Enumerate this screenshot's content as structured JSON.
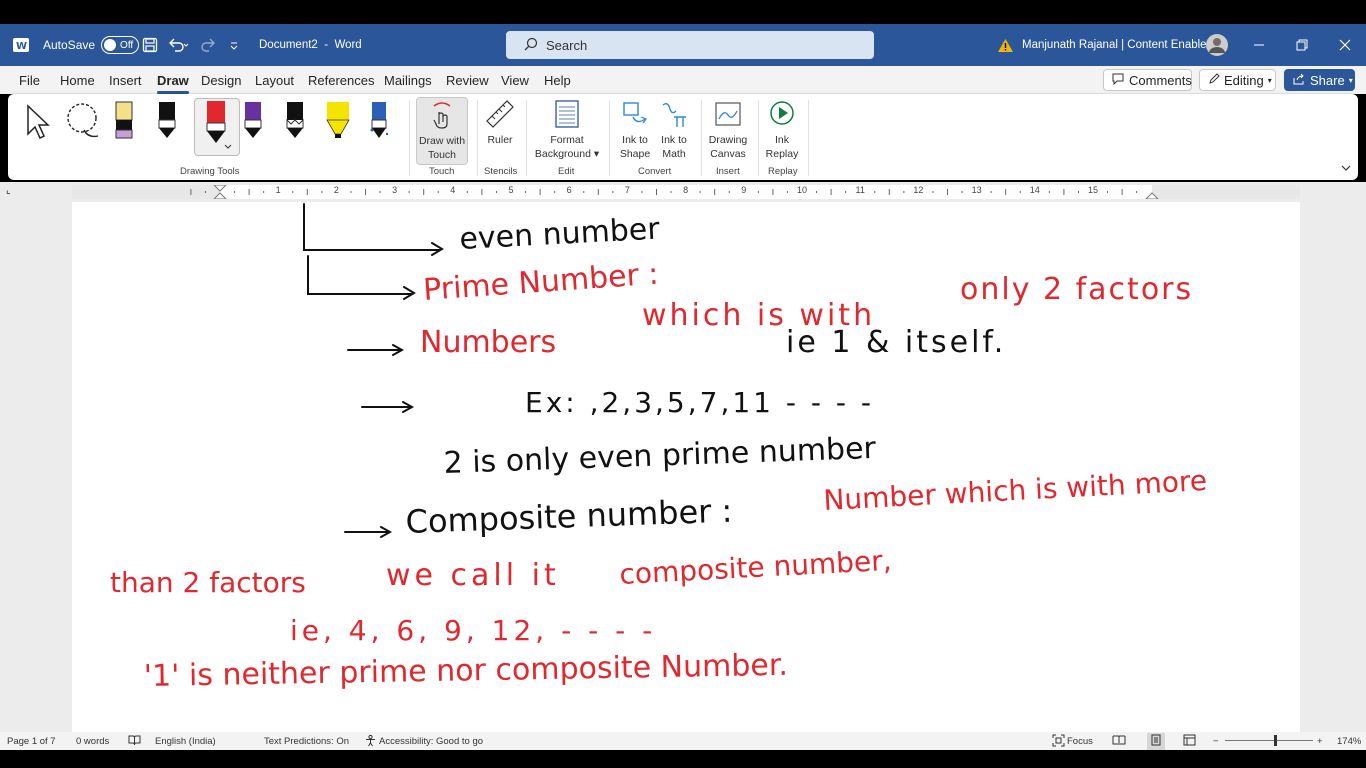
{
  "titlebar": {
    "autosave_label": "AutoSave",
    "autosave_state": "Off",
    "doc_title": "Document2",
    "title_sep": "-",
    "app_name": "Word",
    "search_placeholder": "Search",
    "user_name": "Manjunath Rajanal | Content Enablers"
  },
  "menu": {
    "file": "File",
    "home": "Home",
    "insert": "Insert",
    "draw": "Draw",
    "design": "Design",
    "layout": "Layout",
    "references": "References",
    "mailings": "Mailings",
    "review": "Review",
    "view": "View",
    "help": "Help"
  },
  "actions": {
    "comments": "Comments",
    "editing": "Editing",
    "share": "Share"
  },
  "ribbon": {
    "draw_with_touch_1": "Draw with",
    "draw_with_touch_2": "Touch",
    "ruler": "Ruler",
    "format_bg_1": "Format",
    "format_bg_2": "Background",
    "ink_shape_1": "Ink to",
    "ink_shape_2": "Shape",
    "ink_math_1": "Ink to",
    "ink_math_2": "Math",
    "drawing_canvas_1": "Drawing",
    "drawing_canvas_2": "Canvas",
    "ink_replay_1": "Ink",
    "ink_replay_2": "Replay",
    "groups": {
      "drawing_tools": "Drawing Tools",
      "touch": "Touch",
      "stencils": "Stencils",
      "edit": "Edit",
      "convert": "Convert",
      "insert": "Insert",
      "replay": "Replay"
    },
    "pen_colors": [
      "#f5e08a",
      "#111111",
      "#e0282e",
      "#6a2fa0",
      "#111111",
      "#f4e400",
      "#2b5fb8"
    ]
  },
  "ruler_numbers": [
    "1",
    "2",
    "3",
    "4",
    "5",
    "6",
    "7",
    "8",
    "9",
    "10",
    "11",
    "12",
    "13",
    "14",
    "15"
  ],
  "ink": {
    "even_number": "even number",
    "prime_number": "Prime Number :",
    "numbers": "Numbers",
    "which_is_with": "which is with",
    "only_2_factors": "only 2 factors",
    "ie_1_itself": "ie 1 & itself.",
    "example": "Ex: ,2,3,5,7,11 - - - -",
    "two_only_even_prime": "2 is only even prime number",
    "composite_number": "Composite number :",
    "number_which_more": "Number which is with more",
    "than_2_factors": "than 2 factors",
    "we_call_it": "we call it",
    "composite_number_red": "composite number,",
    "ie_list": "ie, 4, 6, 9, 12, - - - -",
    "one_neither": "'1' is neither prime nor composite Number."
  },
  "status": {
    "page": "Page 1 of 7",
    "words": "0 words",
    "language": "English (India)",
    "predictions": "Text Predictions: On",
    "accessibility": "Accessibility: Good to go",
    "focus": "Focus",
    "zoom_minus": "−",
    "zoom_plus": "+",
    "zoom": "174%"
  }
}
